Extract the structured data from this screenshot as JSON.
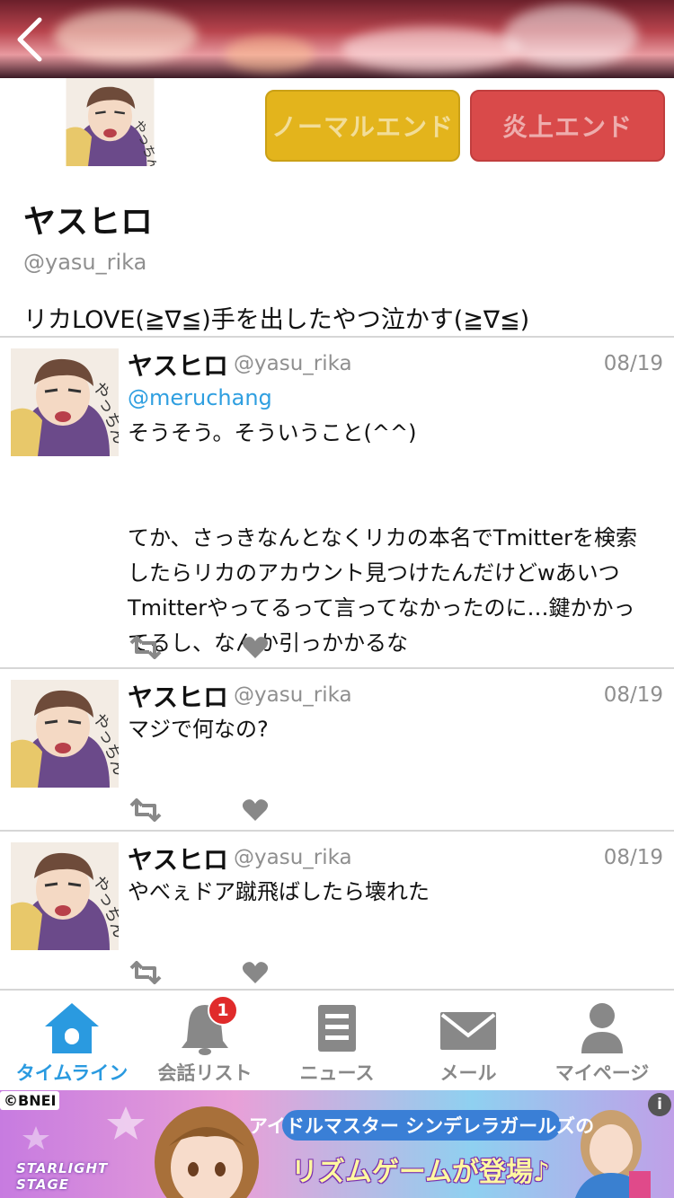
{
  "header": {
    "back_icon": "chevron-left-icon"
  },
  "profile": {
    "name": "ヤスヒロ",
    "handle": "@yasu_rika",
    "bio": "リカLOVE(≧∇≦)手を出したやつ泣かす(≧∇≦)",
    "normal_end_label": "ノーマルエンド",
    "flame_end_label": "炎上エンド",
    "avatar_text": "やっちん"
  },
  "tweets": [
    {
      "name": "ヤスヒロ",
      "handle": "@yasu_rika",
      "date": "08/19",
      "mention": "@meruchang",
      "lines": [
        "そうそう。そういうこと(^^)"
      ],
      "lines2": [
        "てか、さっきなんとなくリカの本名でTmitterを検索",
        "したらリカのアカウント見つけたんだけどwあいつ",
        "Tmitterやってるって言ってなかったのに…鍵かかっ",
        "てるし、なんか引っかかるな"
      ]
    },
    {
      "name": "ヤスヒロ",
      "handle": "@yasu_rika",
      "date": "08/19",
      "lines": [
        "マジで何なの?"
      ]
    },
    {
      "name": "ヤスヒロ",
      "handle": "@yasu_rika",
      "date": "08/19",
      "lines": [
        "やべぇドア蹴飛ばしたら壊れた"
      ]
    }
  ],
  "tabs": [
    {
      "label": "タイムライン",
      "icon": "home-icon",
      "active": true
    },
    {
      "label": "会話リスト",
      "icon": "bell-icon",
      "badge": "1"
    },
    {
      "label": "ニュース",
      "icon": "news-icon"
    },
    {
      "label": "メール",
      "icon": "mail-icon"
    },
    {
      "label": "マイページ",
      "icon": "person-icon"
    }
  ],
  "ad": {
    "copyright": "©BNEI",
    "info": "i",
    "line1": "アイドルマスター シンデレラガールズの",
    "line2": "リズムゲームが登場♪",
    "logo_text": "STARLIGHT STAGE"
  },
  "colors": {
    "accent": "#2a9ae0",
    "mention": "#2f9fe0",
    "normal_end": "#e3b41c",
    "flame_end": "#d94a4a",
    "badge": "#e02b2b",
    "inactive_icon": "#888888"
  }
}
